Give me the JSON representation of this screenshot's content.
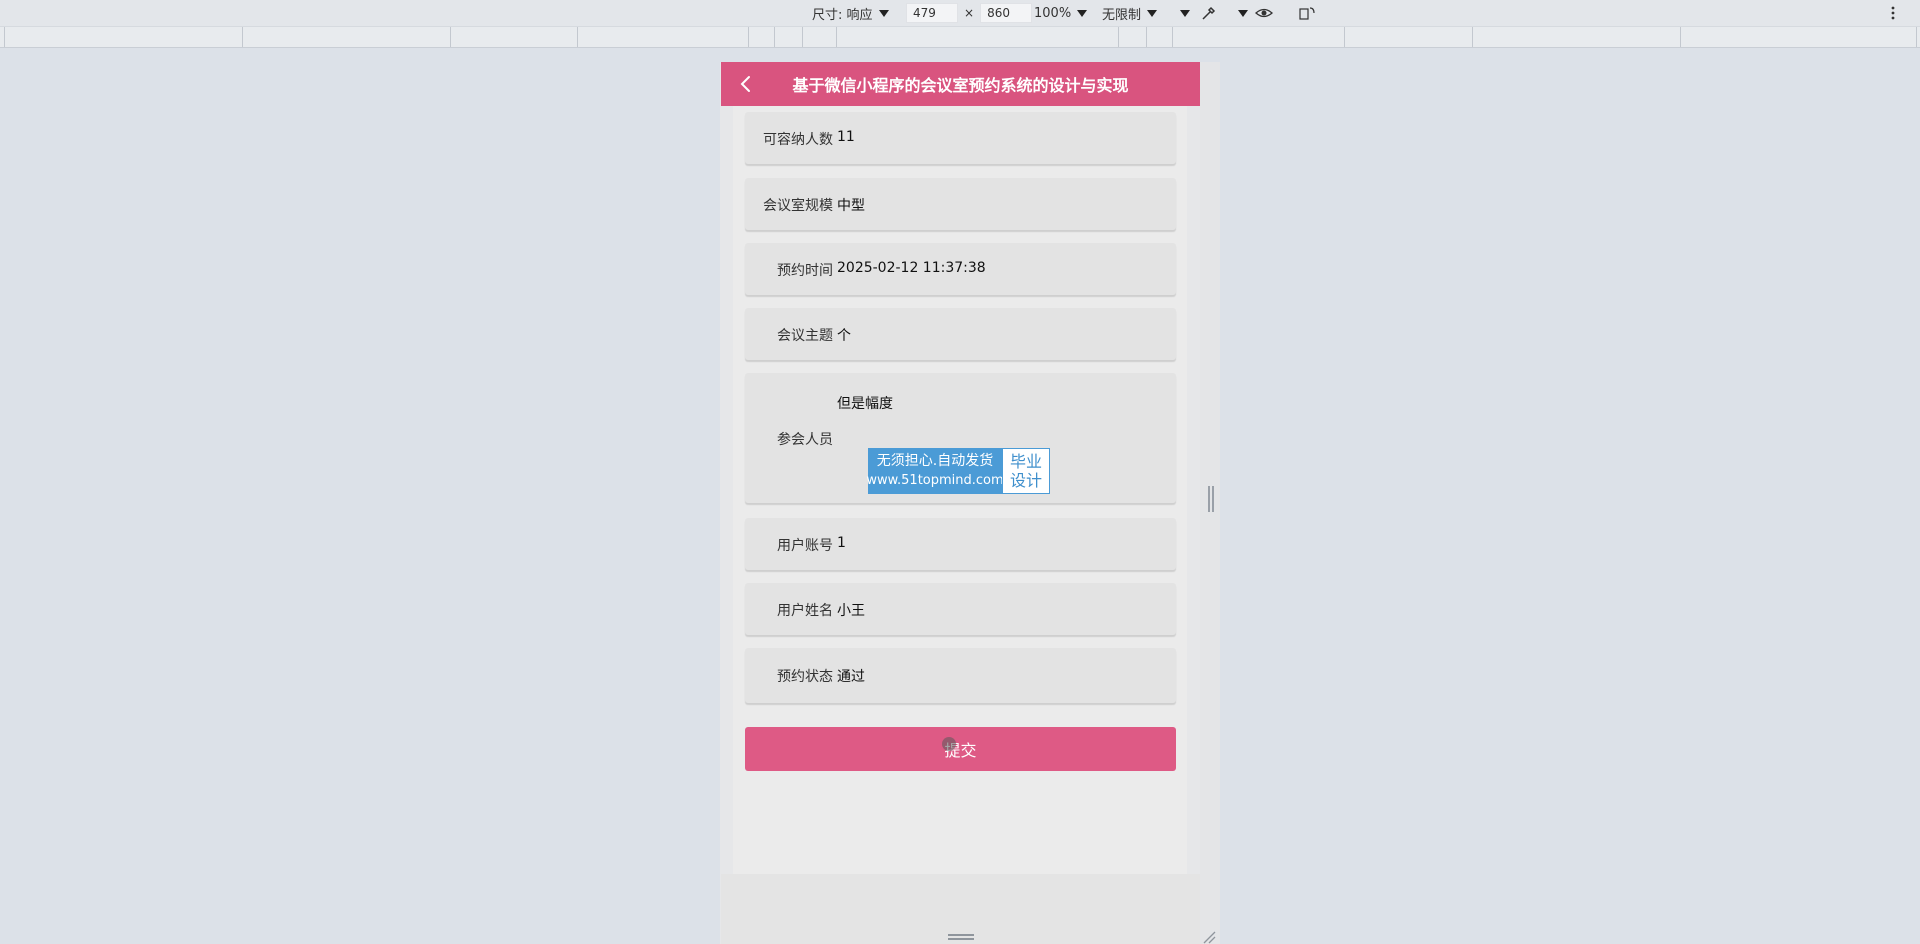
{
  "devtools": {
    "dimensions_label": "尺寸: 响应",
    "width_value": "479",
    "times_sign": "×",
    "height_value": "860",
    "zoom": "100%",
    "throttle": "无限制"
  },
  "app": {
    "title": "基于微信小程序的会议室预约系统的设计与实现",
    "accent_color": "#d9547f"
  },
  "form": {
    "rows": [
      {
        "label": "可容纳人数",
        "value": "11"
      },
      {
        "label": "会议室规模",
        "value": "中型"
      },
      {
        "label": "预约时间",
        "value": "2025-02-12 11:37:38"
      },
      {
        "label": "会议主题",
        "value": "个"
      },
      {
        "label": "参会人员",
        "value": "但是幅度"
      },
      {
        "label": "用户账号",
        "value": "1"
      },
      {
        "label": "用户姓名",
        "value": "小王"
      },
      {
        "label": "预约状态",
        "value": "通过"
      }
    ],
    "submit_label": "提交"
  },
  "watermark": {
    "line1": "无须担心.自动发货",
    "line2": "www.51topmind.com",
    "badge_line1": "毕业",
    "badge_line2": "设计"
  }
}
